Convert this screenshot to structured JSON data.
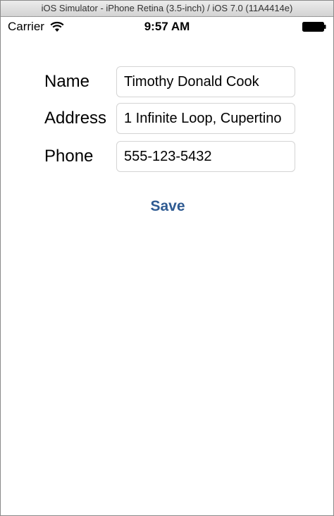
{
  "window": {
    "title": "iOS Simulator - iPhone Retina (3.5-inch) / iOS 7.0 (11A4414e)"
  },
  "status_bar": {
    "carrier": "Carrier",
    "time": "9:57 AM",
    "wifi_icon": "wifi-icon",
    "battery_icon": "battery-icon"
  },
  "form": {
    "name_label": "Name",
    "name_value": "Timothy Donald Cook",
    "address_label": "Address",
    "address_value": "1 Infinite Loop, Cupertino",
    "phone_label": "Phone",
    "phone_value": "555-123-5432"
  },
  "actions": {
    "save_label": "Save"
  },
  "colors": {
    "button_tint": "#2f5b92",
    "field_border": "#d4d4d4"
  }
}
